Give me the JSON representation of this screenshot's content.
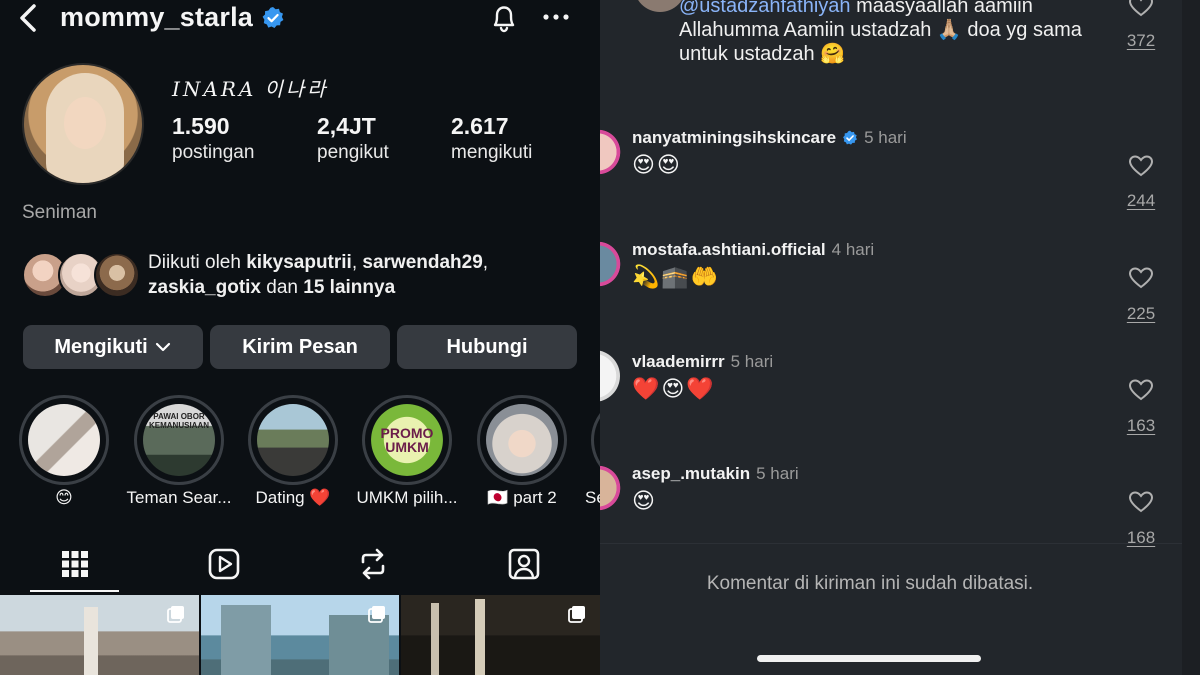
{
  "profile": {
    "username": "mommy_starla",
    "display_name": "𝐼𝑁𝐴𝑅𝐴 이나라",
    "category": "Seniman",
    "stats": [
      {
        "value": "1.590",
        "label": "postingan"
      },
      {
        "value": "2,4JT",
        "label": "pengikut"
      },
      {
        "value": "2.617",
        "label": "mengikuti"
      }
    ],
    "followed_by": {
      "prefix": "Diikuti oleh ",
      "user1": "kikysaputrii",
      "sep1": ", ",
      "user2": "sarwendah29",
      "sep2": ",",
      "user3": "zaskia_gotix",
      "mid": " dan ",
      "others": "15 lainnya"
    },
    "buttons": {
      "following": "Mengikuti",
      "message": "Kirim Pesan",
      "contact": "Hubungi"
    },
    "highlights": [
      {
        "label": "😊"
      },
      {
        "label": "Teman Sear..."
      },
      {
        "label": "Dating ❤️"
      },
      {
        "label": "UMKM pilih..."
      },
      {
        "label": "🇯🇵 part 2"
      },
      {
        "label": "Se"
      }
    ],
    "highlight_texts": {
      "h2_text": "PAWAI OBOR KEMANUSIAAN",
      "h4_text": "PROMO UMKM"
    },
    "tabs": [
      "grid-icon",
      "reels-icon",
      "reposts-icon",
      "tagged-icon"
    ]
  },
  "comments": {
    "first_comment": {
      "mention": "@ustadzahfathiyah",
      "text": " maasyaallah aamiin Allahumma Aamiin ustadzah 🙏🏼 doa yg sama untuk ustadzah 🤗",
      "likes": "372"
    },
    "items": [
      {
        "user": "nanyatminingsihskincare",
        "verified": true,
        "time": "5 hari",
        "text": "😍😍",
        "likes": "244"
      },
      {
        "user": "mostafa.ashtiani.official",
        "verified": false,
        "time": "4 hari",
        "text": "💫🕋🤲",
        "likes": "225"
      },
      {
        "user": "vlaademirrr",
        "verified": false,
        "time": "5 hari",
        "text": "❤️😍❤️",
        "likes": "163"
      },
      {
        "user": "asep_.mutakin",
        "verified": false,
        "time": "5 hari",
        "text": "😍",
        "likes": "168"
      }
    ],
    "limited_notice": "Komentar di kiriman ini sudah dibatasi."
  },
  "colors": {
    "left_bg": "#0c1014",
    "right_bg": "#22262b",
    "button_bg": "#363a40",
    "verified_blue": "#3797f0",
    "mention_blue": "#8ab4f8"
  }
}
